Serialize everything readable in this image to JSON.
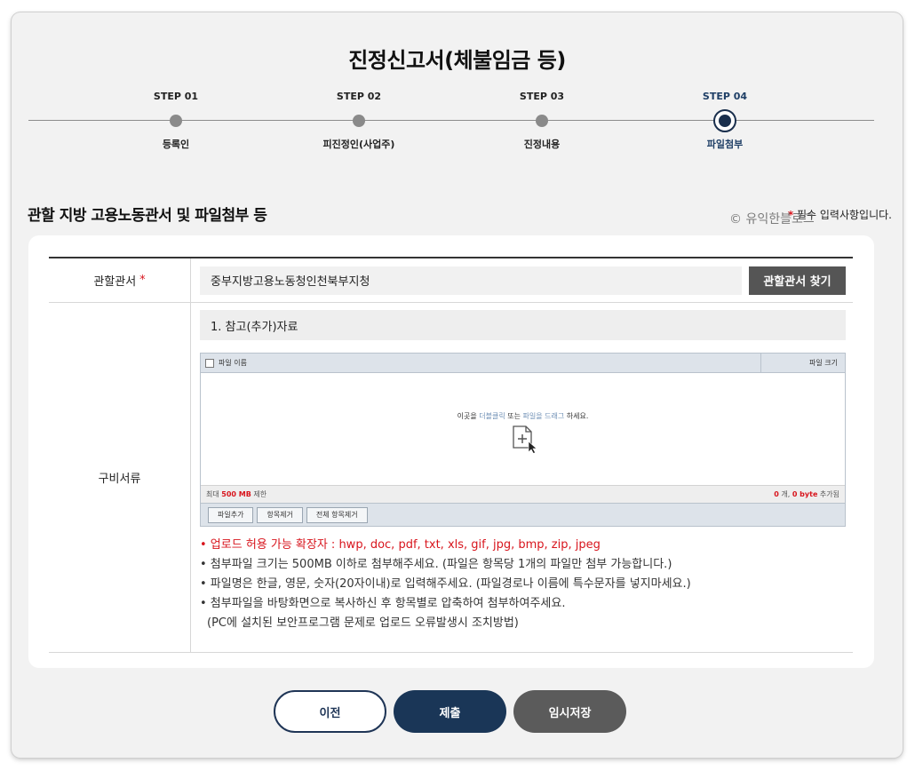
{
  "page": {
    "title": "진정신고서(체불임금 등)"
  },
  "steps": [
    {
      "num": "STEP 01",
      "name": "등록인"
    },
    {
      "num": "STEP 02",
      "name": "피진정인(사업주)"
    },
    {
      "num": "STEP 03",
      "name": "진정내용"
    },
    {
      "num": "STEP 04",
      "name": "파일첨부",
      "active": true
    }
  ],
  "section": {
    "title": "관할 지방 고용노동관서 및 파일첨부 등",
    "required_star": "*",
    "required_note": " 필수 입력사항입니다.",
    "watermark": "© 유익한블로그"
  },
  "form": {
    "office": {
      "label": "관할관서",
      "required_mark": "*",
      "value": "중부지방고용노동청인천북부지청",
      "find_button": "관할관서 찾기"
    },
    "documents": {
      "label": "구비서류",
      "item_title": "1. 참고(추가)자료",
      "uploader": {
        "col_name": "파일 이름",
        "col_size": "파일 크기",
        "drop_pre": "이곳을 ",
        "drop_dblclick": "더블클릭",
        "drop_mid": " 또는 ",
        "drop_drag": "파일을 드래그",
        "drop_post": " 하세요.",
        "limit_pre": "최대 ",
        "limit_value": "500 MB",
        "limit_post": " 제한",
        "count_value": "0",
        "count_mid": " 개, ",
        "bytes_value": "0 byte",
        "count_post": " 추가됨",
        "btn_add": "파일추가",
        "btn_remove": "항목제거",
        "btn_remove_all": "전체 항목제거"
      },
      "notes": {
        "ext": "• 업로드 허용 가능 확장자 : hwp, doc, pdf, txt, xls, gif, jpg, bmp, zip, jpeg",
        "size": "• 첨부파일 크기는 500MB 이하로 첨부해주세요. (파일은 항목당 1개의 파일만 첨부 가능합니다.)",
        "name": "• 파일명은 한글, 영문, 숫자(20자이내)로 입력해주세요. (파일경로나 이름에 특수문자를 넣지마세요.)",
        "desktop": "• 첨부파일을 바탕화면으로 복사하신 후 항목별로 압축하여 첨부하여주세요.",
        "desktop2": "(PC에 설치된 보안프로그램 문제로 업로드 오류발생시 조치방법)"
      }
    }
  },
  "buttons": {
    "prev": "이전",
    "submit": "제출",
    "temp_save": "임시저장"
  }
}
